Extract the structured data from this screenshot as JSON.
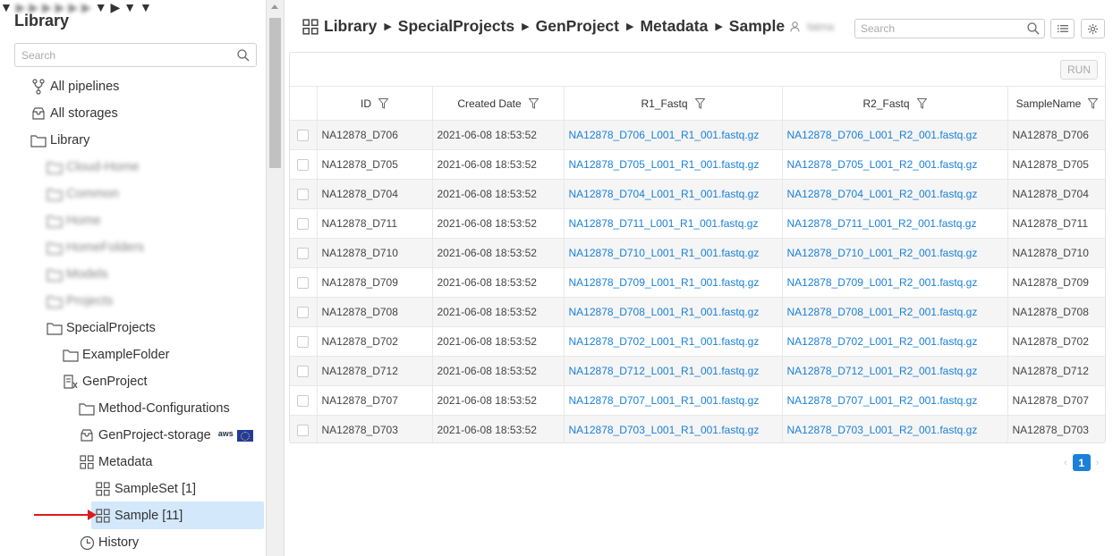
{
  "sidebar": {
    "title": "Library",
    "search_placeholder": "Search",
    "items": [
      {
        "label": "All pipelines"
      },
      {
        "label": "All storages"
      },
      {
        "label": "Library"
      },
      {
        "label": "Cloud-Home"
      },
      {
        "label": "Common"
      },
      {
        "label": "Home"
      },
      {
        "label": "HomeFolders"
      },
      {
        "label": "Models"
      },
      {
        "label": "Projects"
      },
      {
        "label": "SpecialProjects"
      },
      {
        "label": "ExampleFolder"
      },
      {
        "label": "GenProject"
      },
      {
        "label": "Method-Configurations"
      },
      {
        "label": "GenProject-storage",
        "badge": "aws"
      },
      {
        "label": "Metadata"
      },
      {
        "label": "SampleSet [1]"
      },
      {
        "label": "Sample [11]"
      },
      {
        "label": "History"
      }
    ]
  },
  "header": {
    "breadcrumb": [
      "Library",
      "SpecialProjects",
      "GenProject",
      "Metadata",
      "Sample"
    ],
    "owner": "fatma",
    "search_placeholder": "Search"
  },
  "table": {
    "run_label": "RUN",
    "columns": [
      "ID",
      "Created Date",
      "R1_Fastq",
      "R2_Fastq",
      "SampleName"
    ],
    "rows": [
      [
        "NA12878_D706",
        "2021-06-08 18:53:52",
        "NA12878_D706_L001_R1_001.fastq.gz",
        "NA12878_D706_L001_R2_001.fastq.gz",
        "NA12878_D706"
      ],
      [
        "NA12878_D705",
        "2021-06-08 18:53:52",
        "NA12878_D705_L001_R1_001.fastq.gz",
        "NA12878_D705_L001_R2_001.fastq.gz",
        "NA12878_D705"
      ],
      [
        "NA12878_D704",
        "2021-06-08 18:53:52",
        "NA12878_D704_L001_R1_001.fastq.gz",
        "NA12878_D704_L001_R2_001.fastq.gz",
        "NA12878_D704"
      ],
      [
        "NA12878_D711",
        "2021-06-08 18:53:52",
        "NA12878_D711_L001_R1_001.fastq.gz",
        "NA12878_D711_L001_R2_001.fastq.gz",
        "NA12878_D711"
      ],
      [
        "NA12878_D710",
        "2021-06-08 18:53:52",
        "NA12878_D710_L001_R1_001.fastq.gz",
        "NA12878_D710_L001_R2_001.fastq.gz",
        "NA12878_D710"
      ],
      [
        "NA12878_D709",
        "2021-06-08 18:53:52",
        "NA12878_D709_L001_R1_001.fastq.gz",
        "NA12878_D709_L001_R2_001.fastq.gz",
        "NA12878_D709"
      ],
      [
        "NA12878_D708",
        "2021-06-08 18:53:52",
        "NA12878_D708_L001_R1_001.fastq.gz",
        "NA12878_D708_L001_R2_001.fastq.gz",
        "NA12878_D708"
      ],
      [
        "NA12878_D702",
        "2021-06-08 18:53:52",
        "NA12878_D702_L001_R1_001.fastq.gz",
        "NA12878_D702_L001_R2_001.fastq.gz",
        "NA12878_D702"
      ],
      [
        "NA12878_D712",
        "2021-06-08 18:53:52",
        "NA12878_D712_L001_R1_001.fastq.gz",
        "NA12878_D712_L001_R2_001.fastq.gz",
        "NA12878_D712"
      ],
      [
        "NA12878_D707",
        "2021-06-08 18:53:52",
        "NA12878_D707_L001_R1_001.fastq.gz",
        "NA12878_D707_L001_R2_001.fastq.gz",
        "NA12878_D707"
      ],
      [
        "NA12878_D703",
        "2021-06-08 18:53:52",
        "NA12878_D703_L001_R1_001.fastq.gz",
        "NA12878_D703_L001_R2_001.fastq.gz",
        "NA12878_D703"
      ]
    ]
  },
  "pagination": {
    "current_page": "1"
  },
  "colors": {
    "accent": "#1a80d9",
    "selected_bg": "#d3e8fb",
    "annotation_arrow": "#e0191c"
  }
}
